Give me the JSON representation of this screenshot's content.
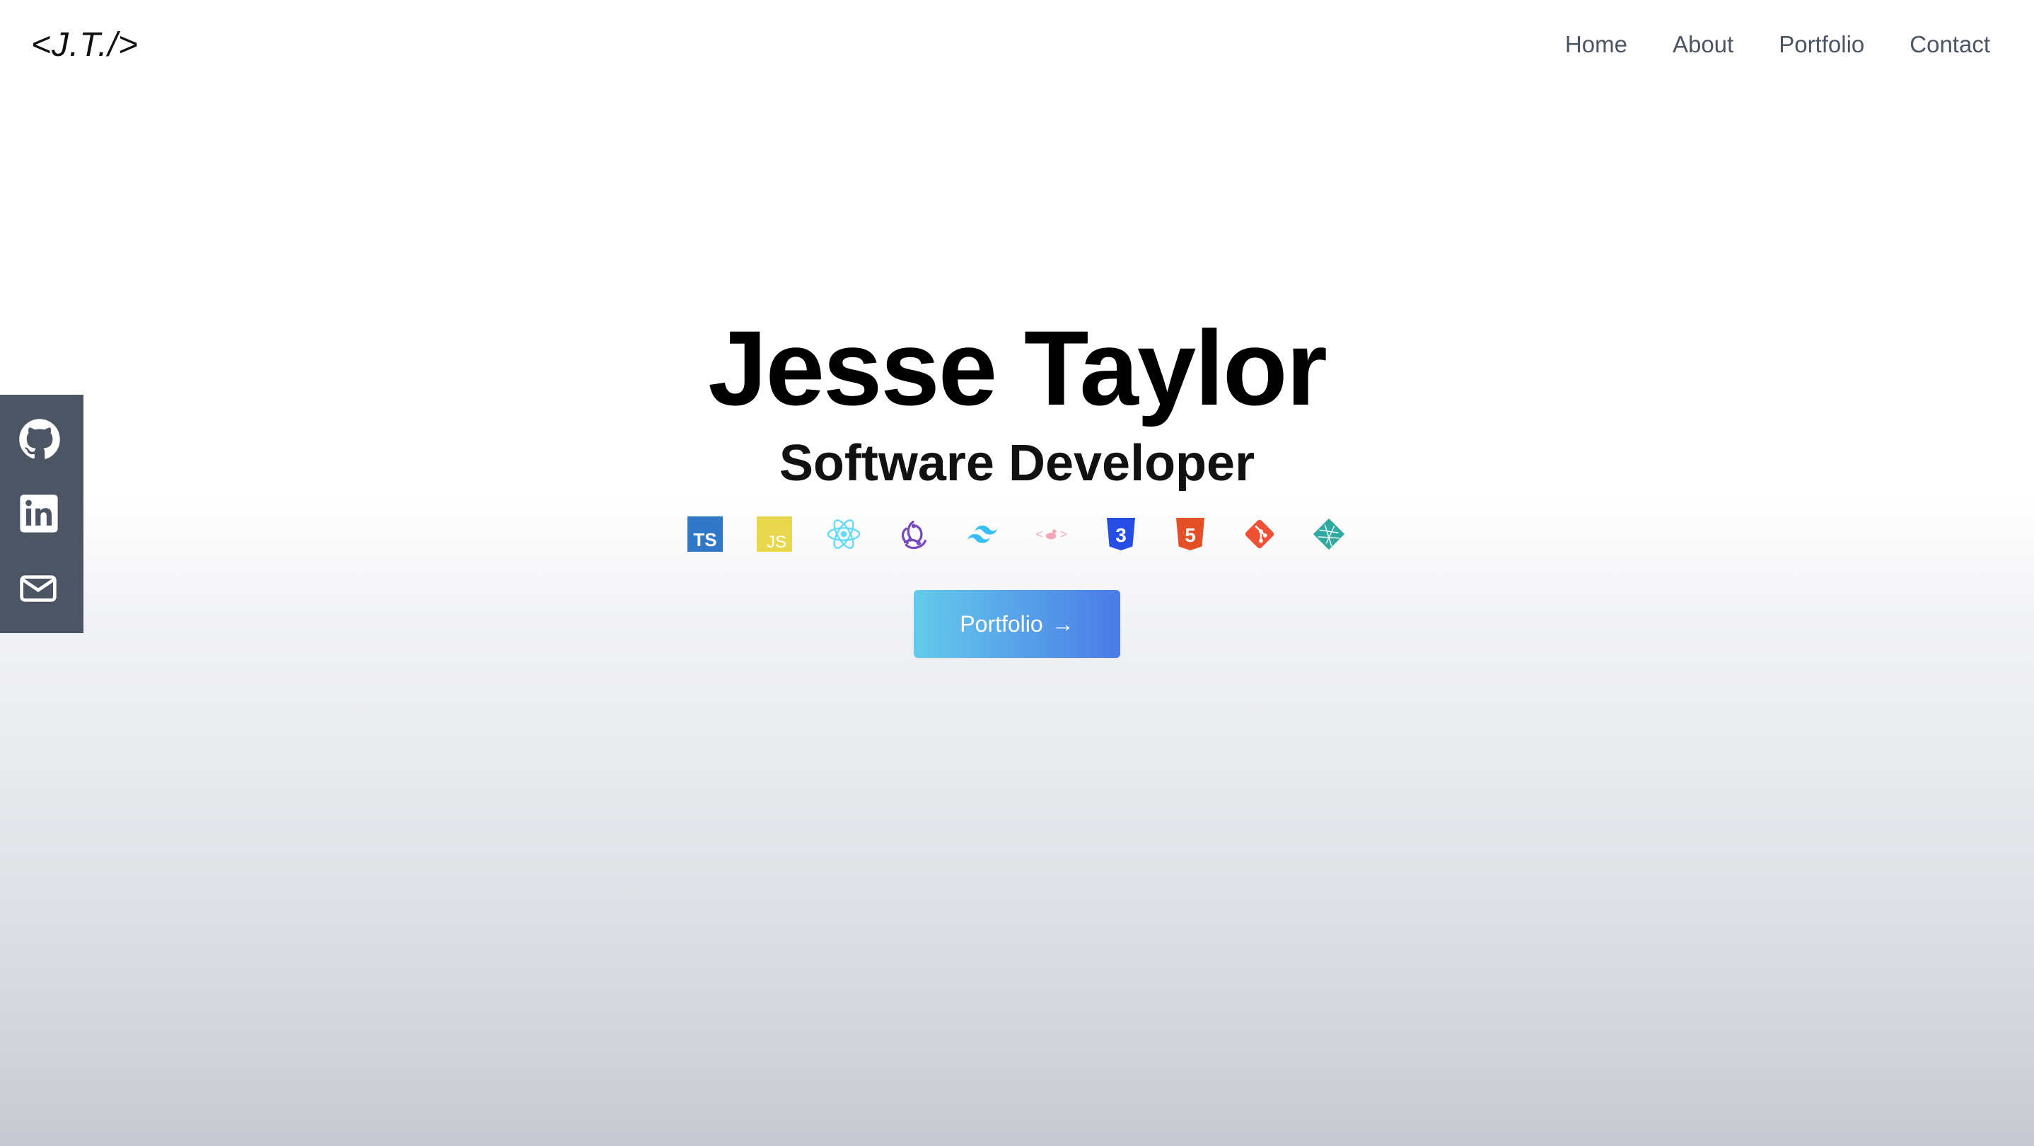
{
  "header": {
    "logo": "<J.T./>",
    "nav": [
      "Home",
      "About",
      "Portfolio",
      "Contact"
    ]
  },
  "hero": {
    "name": "Jesse Taylor",
    "title": "Software Developer",
    "cta_label": "Portfolio",
    "cta_arrow": "→"
  },
  "tech_icons": [
    {
      "name": "typescript-icon",
      "label": "TS",
      "color": "#3178c6"
    },
    {
      "name": "javascript-icon",
      "label": "JS",
      "color": "#e8d84e"
    },
    {
      "name": "react-icon",
      "color": "#61dafb"
    },
    {
      "name": "redux-icon",
      "color": "#764abc"
    },
    {
      "name": "tailwind-icon",
      "color": "#38bdf8"
    },
    {
      "name": "styled-components-icon",
      "color": "#f4a6b7"
    },
    {
      "name": "css3-icon",
      "label": "3",
      "color": "#264de4"
    },
    {
      "name": "html5-icon",
      "label": "5",
      "color": "#e34f26"
    },
    {
      "name": "git-icon",
      "color": "#f05033"
    },
    {
      "name": "netlify-icon",
      "color": "#30a9a0"
    }
  ],
  "social": {
    "background": "#4b5563",
    "items": [
      "github-icon",
      "linkedin-icon",
      "email-icon"
    ]
  },
  "colors": {
    "nav_text": "#4b5563",
    "cta_gradient_start": "#64cbea",
    "cta_gradient_end": "#4b7be8"
  }
}
